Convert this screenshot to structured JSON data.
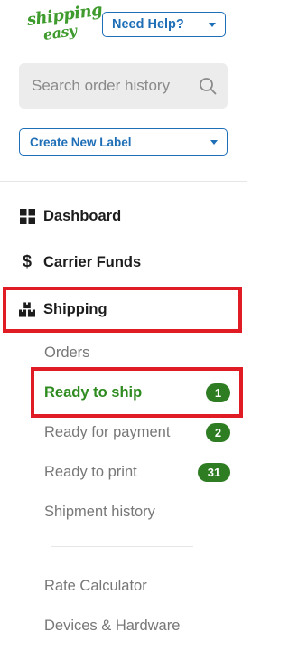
{
  "header": {
    "logo_line1": "shipping",
    "logo_line2": "easy",
    "help_label": "Need Help?"
  },
  "search": {
    "placeholder": "Search order history"
  },
  "create_label": "Create New Label",
  "nav": {
    "dashboard": "Dashboard",
    "carrier_funds": "Carrier Funds",
    "shipping": "Shipping"
  },
  "shipping_sub": {
    "orders": "Orders",
    "ready_to_ship": "Ready to ship",
    "ready_to_ship_count": "1",
    "ready_for_payment": "Ready for payment",
    "ready_for_payment_count": "2",
    "ready_to_print": "Ready to print",
    "ready_to_print_count": "31",
    "shipment_history": "Shipment history"
  },
  "tools": {
    "rate_calculator": "Rate Calculator",
    "devices_hardware": "Devices & Hardware"
  },
  "colors": {
    "brand_green": "#3f9b2d",
    "link_blue": "#1f6fb7",
    "badge_green": "#2e7d23",
    "highlight_red": "#e01b24"
  }
}
